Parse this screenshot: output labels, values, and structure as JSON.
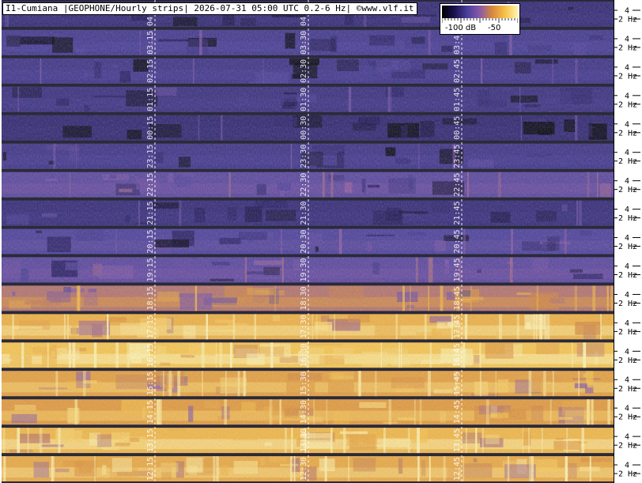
{
  "header": {
    "title": "I1-Cumiana |GEOPHONE/Hourly strips| 2026-07-31 05:00 UTC 0.2-6 Hz| ©www.vlf.it"
  },
  "colorbar": {
    "label_low": "-100 dB",
    "label_high": "-50",
    "colors": [
      "#000000",
      "#1a1250",
      "#4a3f9a",
      "#8a5aa8",
      "#d88a3a",
      "#f7c24a",
      "#fff3b0"
    ]
  },
  "chart_data": {
    "type": "heatmap",
    "title": "I1-Cumiana |GEOPHONE/Hourly strips| 2026-07-31 05:00 UTC 0.2-6 Hz| ©www.vlf.it",
    "freq_ticks": [
      {
        "value": 4,
        "label": "4"
      },
      {
        "value": 2,
        "label": "2 Hz"
      }
    ],
    "freq_range_hz": [
      0.2,
      6
    ],
    "color_scale": {
      "min_db": -100,
      "max_db": -50
    },
    "strips": [
      {
        "hour": "04",
        "labels": [
          "04:15",
          "04:30",
          "04:45"
        ],
        "intensity": 0.15
      },
      {
        "hour": "03",
        "labels": [
          "03:15",
          "03:30",
          "03:45"
        ],
        "intensity": 0.22
      },
      {
        "hour": "02",
        "labels": [
          "02:15",
          "02:30",
          "02:45"
        ],
        "intensity": 0.2
      },
      {
        "hour": "01",
        "labels": [
          "01:15",
          "01:30",
          "01:45"
        ],
        "intensity": 0.18
      },
      {
        "hour": "00",
        "labels": [
          "00:15",
          "00:30",
          "00:45"
        ],
        "intensity": 0.14
      },
      {
        "hour": "23",
        "labels": [
          "23:15",
          "23:30",
          "23:45"
        ],
        "intensity": 0.2
      },
      {
        "hour": "22",
        "labels": [
          "22:15",
          "22:30",
          "22:45"
        ],
        "intensity": 0.3
      },
      {
        "hour": "21",
        "labels": [
          "21:15",
          "21:30",
          "21:45"
        ],
        "intensity": 0.16
      },
      {
        "hour": "20",
        "labels": [
          "20:15",
          "20:30",
          "20:45"
        ],
        "intensity": 0.26
      },
      {
        "hour": "19",
        "labels": [
          "19:15",
          "19:30",
          "19:45"
        ],
        "intensity": 0.3
      },
      {
        "hour": "18",
        "labels": [
          "18:15",
          "18:30",
          "18:45"
        ],
        "intensity": 0.55
      },
      {
        "hour": "17",
        "labels": [
          "17:15",
          "17:30",
          "17:45"
        ],
        "intensity": 0.78
      },
      {
        "hour": "16",
        "labels": [
          "16:15",
          "16:30",
          "16:45"
        ],
        "intensity": 0.85
      },
      {
        "hour": "15",
        "labels": [
          "15:15",
          "15:30",
          "15:45"
        ],
        "intensity": 0.72
      },
      {
        "hour": "14",
        "labels": [
          "14:15",
          "14:30",
          "14:45"
        ],
        "intensity": 0.7
      },
      {
        "hour": "13",
        "labels": [
          "13:15",
          "13:30",
          "13:45"
        ],
        "intensity": 0.8
      },
      {
        "hour": "12",
        "labels": [
          "12:15",
          "12:30",
          "12:45"
        ],
        "intensity": 0.75
      }
    ],
    "grid": "dashed vertical lines at quarter hours"
  }
}
